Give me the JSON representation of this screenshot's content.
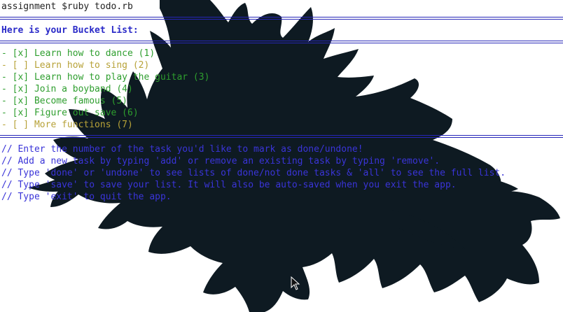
{
  "terminal": {
    "prompt": "assignment $ruby todo.rb",
    "header": "Here is your Bucket List:",
    "tasks": [
      {
        "text": "- [x] Learn how to dance (1)",
        "done": true
      },
      {
        "text": "- [ ] Learn how to sing (2)",
        "done": false
      },
      {
        "text": "- [x] Learn how to play the guitar (3)",
        "done": true
      },
      {
        "text": "- [x] Join a boyband (4)",
        "done": true
      },
      {
        "text": "- [x] Become famous (5)",
        "done": true
      },
      {
        "text": "- [x] Figure out save (6)",
        "done": true
      },
      {
        "text": "- [ ] More functions (7)",
        "done": false
      }
    ],
    "instructions": [
      "// Enter the number of the task you'd like to mark as done/undone!",
      "// Add a new task by typing 'add' or remove an existing task by typing 'remove'.",
      "// Type 'done' or 'undone' to see lists of done/not done tasks & 'all' to see the full list.",
      "// Type 'save' to save your list. It will also be auto-saved when you exit the app.",
      "// Type 'exit' to quit the app."
    ]
  },
  "colors": {
    "background": "#ffffff",
    "splat": "#0e1a22",
    "rule": "#2626b8",
    "header": "#2a2ac8",
    "done": "#2e9e2e",
    "undone": "#b7a238",
    "help": "#3a34d8"
  },
  "icons": {
    "cursor": "mouse-pointer-icon"
  }
}
